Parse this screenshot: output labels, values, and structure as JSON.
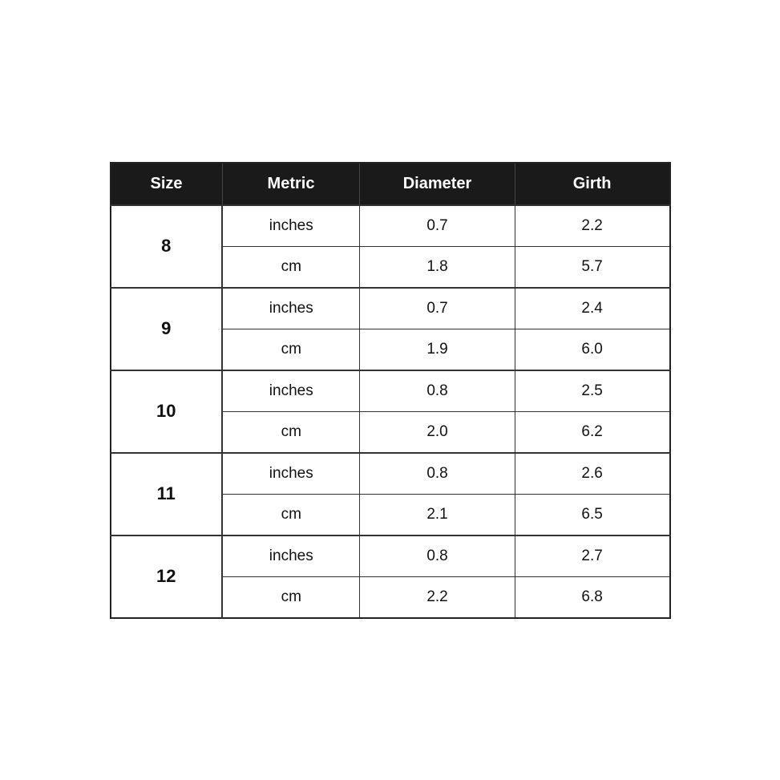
{
  "table": {
    "headers": {
      "size": "Size",
      "metric": "Metric",
      "diameter": "Diameter",
      "girth": "Girth"
    },
    "rows": [
      {
        "size": "8",
        "subrows": [
          {
            "metric": "inches",
            "diameter": "0.7",
            "girth": "2.2"
          },
          {
            "metric": "cm",
            "diameter": "1.8",
            "girth": "5.7"
          }
        ]
      },
      {
        "size": "9",
        "subrows": [
          {
            "metric": "inches",
            "diameter": "0.7",
            "girth": "2.4"
          },
          {
            "metric": "cm",
            "diameter": "1.9",
            "girth": "6.0"
          }
        ]
      },
      {
        "size": "10",
        "subrows": [
          {
            "metric": "inches",
            "diameter": "0.8",
            "girth": "2.5"
          },
          {
            "metric": "cm",
            "diameter": "2.0",
            "girth": "6.2"
          }
        ]
      },
      {
        "size": "11",
        "subrows": [
          {
            "metric": "inches",
            "diameter": "0.8",
            "girth": "2.6"
          },
          {
            "metric": "cm",
            "diameter": "2.1",
            "girth": "6.5"
          }
        ]
      },
      {
        "size": "12",
        "subrows": [
          {
            "metric": "inches",
            "diameter": "0.8",
            "girth": "2.7"
          },
          {
            "metric": "cm",
            "diameter": "2.2",
            "girth": "6.8"
          }
        ]
      }
    ]
  }
}
